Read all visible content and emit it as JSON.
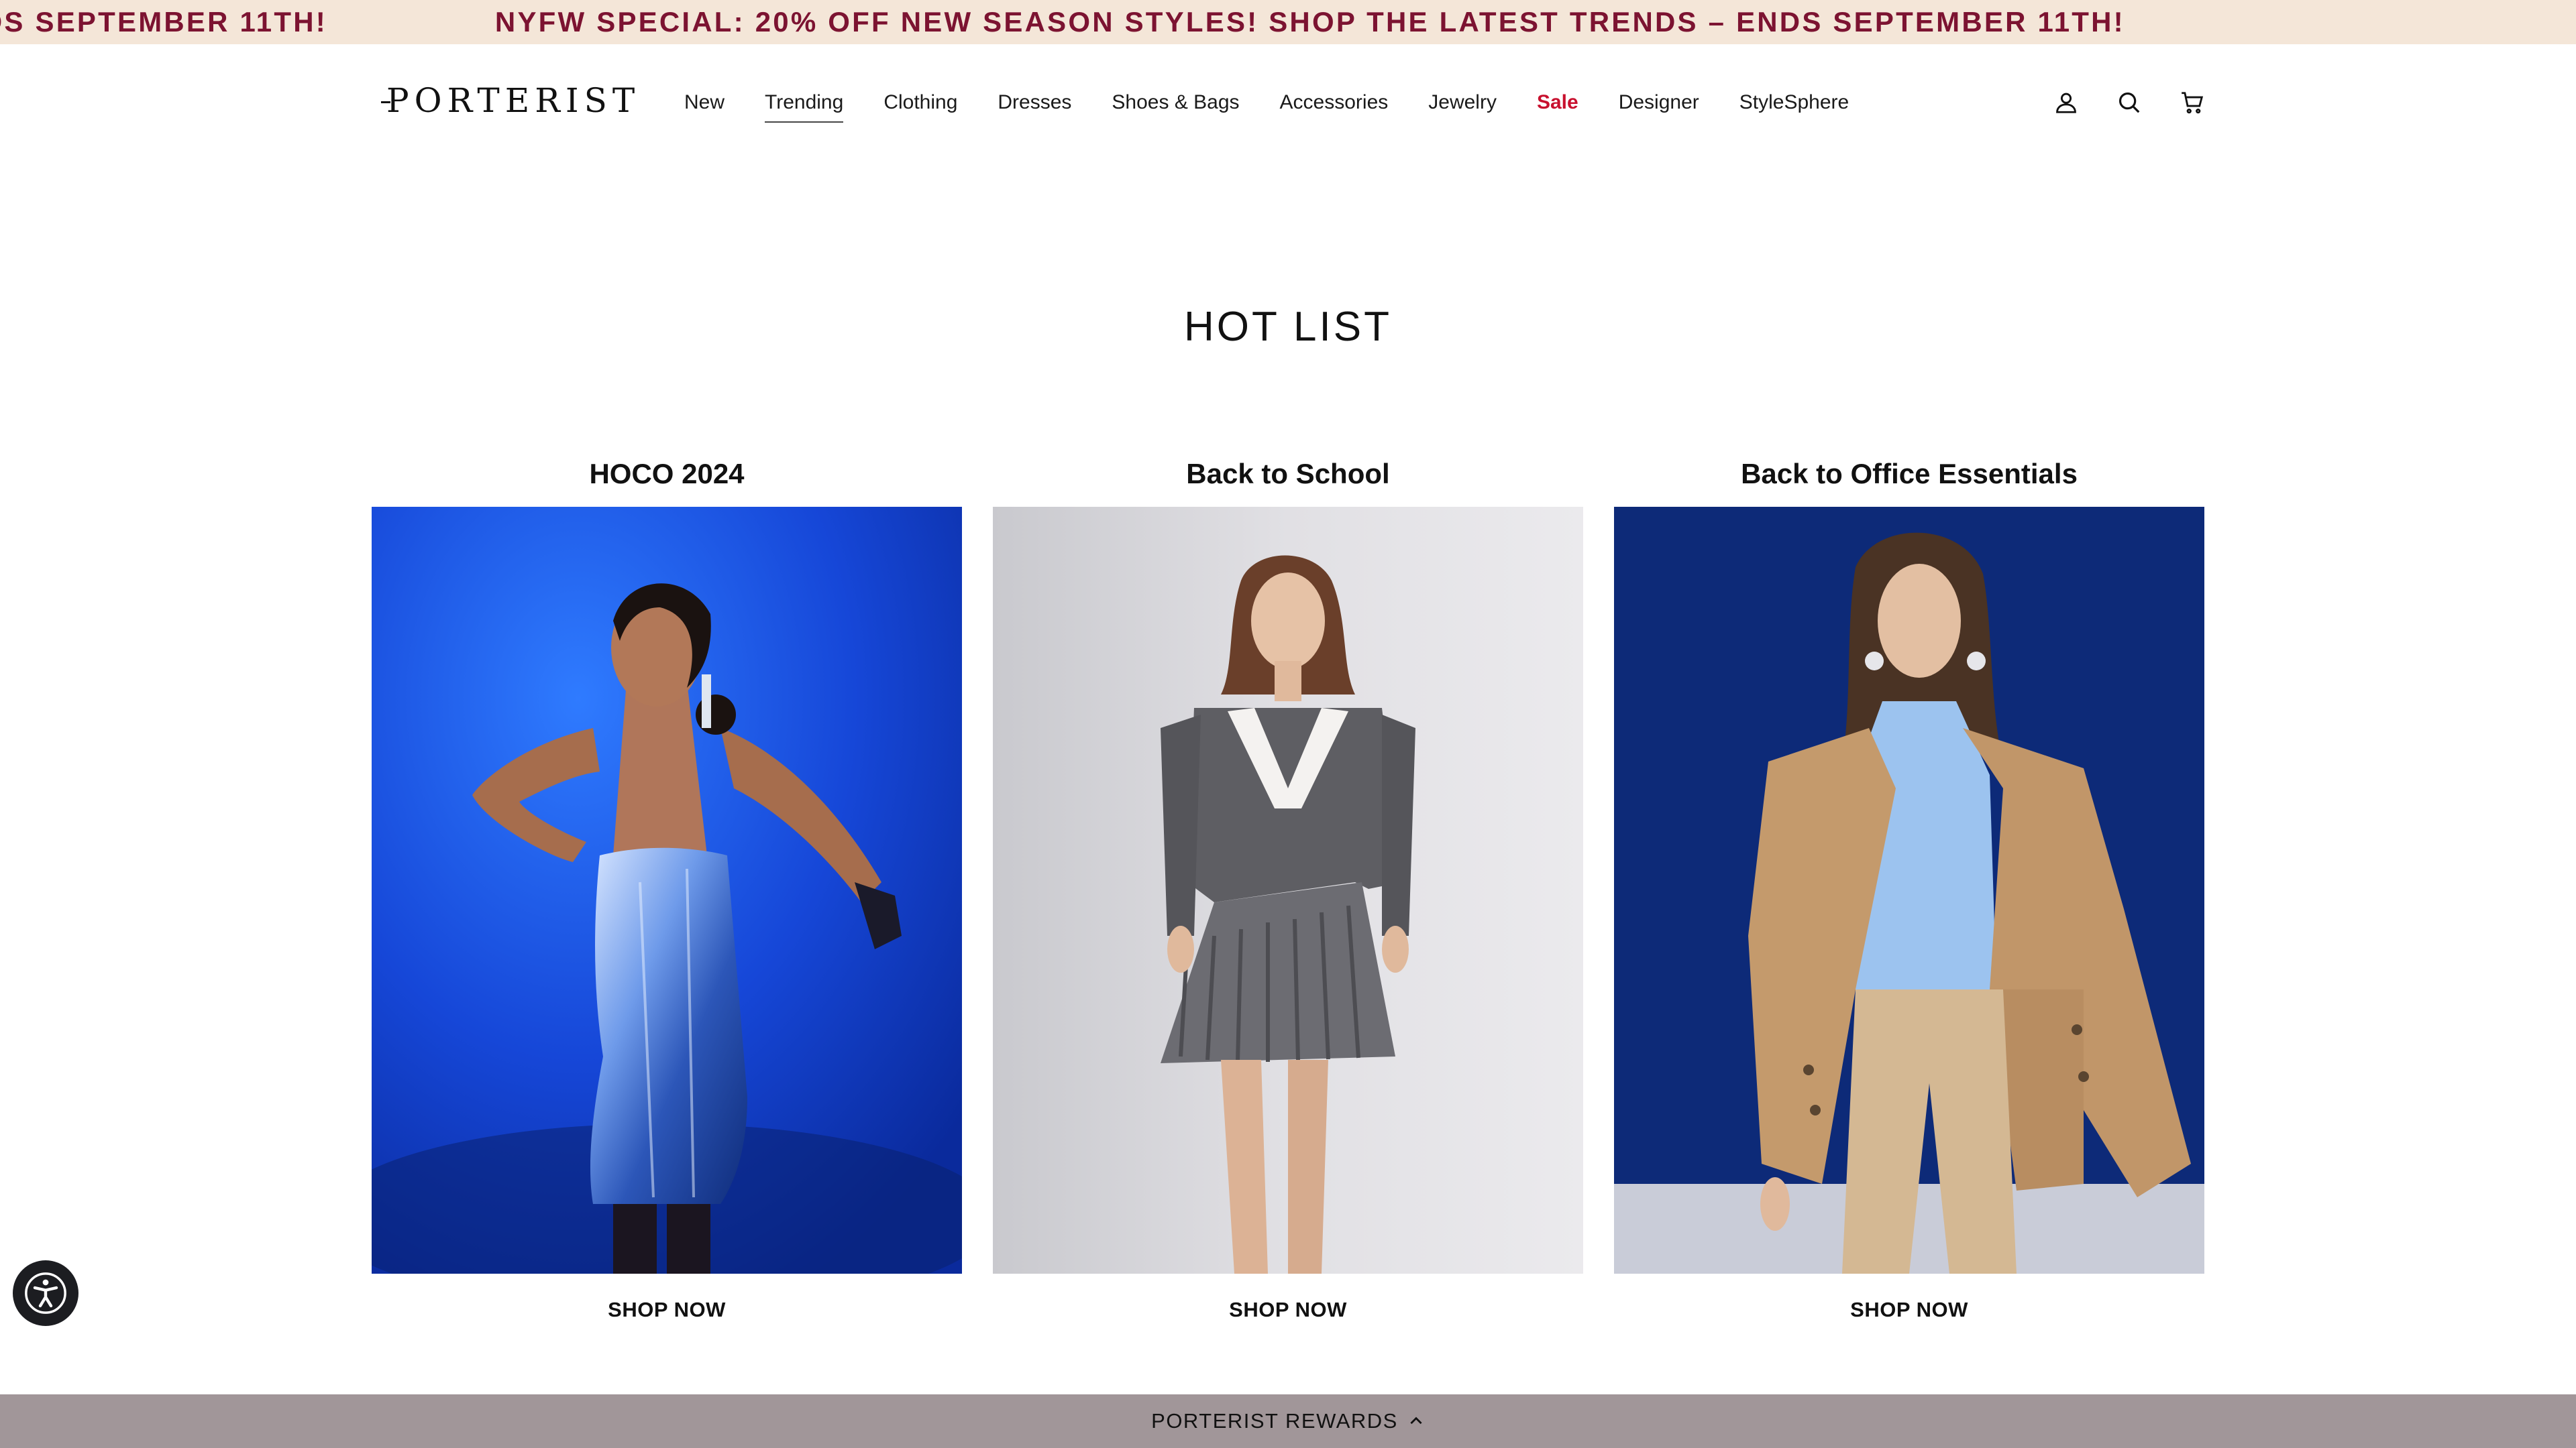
{
  "announcement": {
    "messages": [
      "NYFW SPECIAL: 20% OFF NEW SEASON STYLES! SHOP THE LATEST TRENDS – ENDS SEPTEMBER 11TH!",
      "NYFW SPECIAL: 20% OFF NEW SEASON STYLES! SHOP THE LATEST TRENDS – ENDS SEPTEMBER 11TH!"
    ],
    "color": "#7c1331",
    "background": "#f4e6d8"
  },
  "header": {
    "logo": "PORTERIST",
    "nav": [
      {
        "label": "New"
      },
      {
        "label": "Trending",
        "active": true
      },
      {
        "label": "Clothing"
      },
      {
        "label": "Dresses"
      },
      {
        "label": "Shoes & Bags"
      },
      {
        "label": "Accessories"
      },
      {
        "label": "Jewelry"
      },
      {
        "label": "Sale",
        "highlight": true
      },
      {
        "label": "Designer"
      },
      {
        "label": "StyleSphere"
      }
    ],
    "icons": [
      "account-icon",
      "search-icon",
      "cart-icon"
    ],
    "sale_color": "#c8102e"
  },
  "hot_list": {
    "title": "HOT LIST",
    "cards": [
      {
        "title": "HOCO 2024",
        "cta": "SHOP NOW",
        "image": "model in metallic blue strapless mini dress on blue backdrop"
      },
      {
        "title": "Back to School",
        "cta": "SHOP NOW",
        "image": "model in grey pinstripe cropped blazer and pleated skirt on light grey backdrop"
      },
      {
        "title": "Back to Office Essentials",
        "cta": "SHOP NOW",
        "image": "model in camel coat, light blue knit top and camel trousers on navy backdrop"
      }
    ]
  },
  "accessibility": {
    "icon": "accessibility-icon"
  },
  "rewards": {
    "label": "PORTERIST REWARDS",
    "icon": "chevron-up-icon",
    "background": "#a19699"
  }
}
